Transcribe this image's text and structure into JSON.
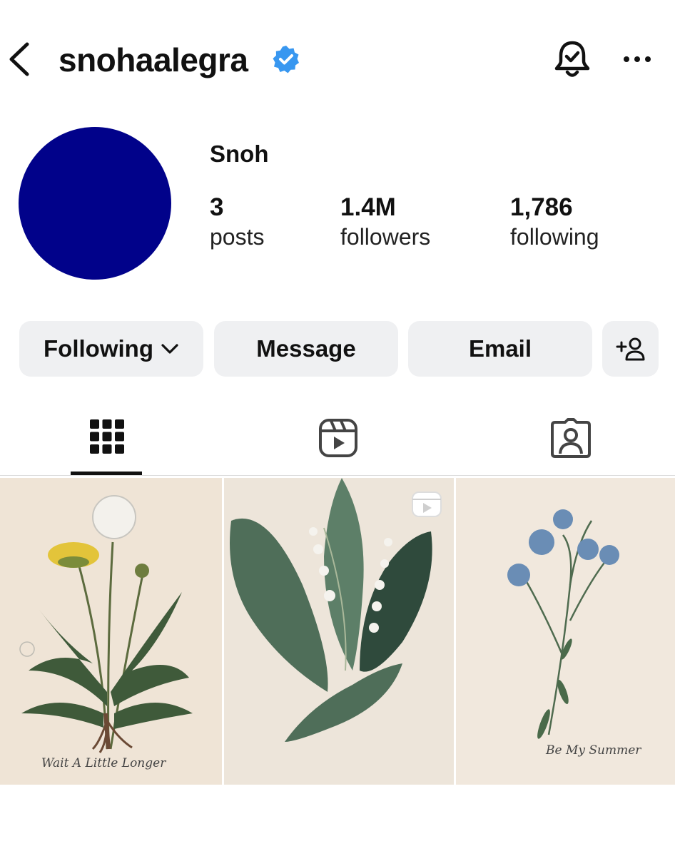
{
  "header": {
    "username": "snohaalegra",
    "back_icon": "chevron-left-icon",
    "verified_icon": "verified-badge-icon",
    "notifications_icon": "bell-check-icon",
    "more_icon": "more-horizontal-icon",
    "verified_color": "#3897f0"
  },
  "profile": {
    "display_name": "Snoh",
    "avatar_color": "#01028a",
    "stats": [
      {
        "value": "3",
        "label": "posts"
      },
      {
        "value": "1.4M",
        "label": "followers"
      },
      {
        "value": "1,786",
        "label": "following"
      }
    ]
  },
  "actions": {
    "following_label": "Following",
    "message_label": "Message",
    "email_label": "Email",
    "suggest_icon": "add-person-icon"
  },
  "tabs": [
    {
      "name": "posts",
      "icon": "grid-icon",
      "active": true
    },
    {
      "name": "reels",
      "icon": "reels-icon",
      "active": false
    },
    {
      "name": "tagged",
      "icon": "tagged-person-icon",
      "active": false
    }
  ],
  "posts": [
    {
      "caption": "Wait A Little Longer",
      "subject": "dandelion illustration"
    },
    {
      "caption": "",
      "subject": "lily of the valley illustration",
      "is_reel": true
    },
    {
      "caption": "Be My Summer",
      "subject": "blue flax flower illustration"
    }
  ]
}
